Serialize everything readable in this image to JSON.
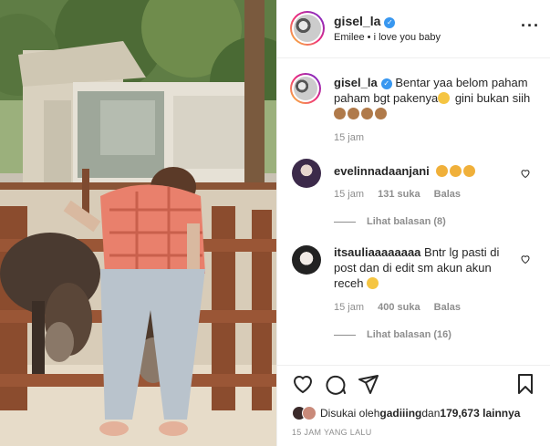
{
  "post": {
    "author": "gisel_la",
    "audio_subtitle": "Emilee • i love you baby",
    "caption_author": "gisel_la",
    "caption_text": "Bentar yaa belom paham paham bgt pakenya",
    "caption_text_2": " gini bukan siih",
    "caption_time": "15 jam"
  },
  "comments": [
    {
      "username": "evelinnadaanjani",
      "time": "15 jam",
      "likes": "131 suka",
      "reply": "Balas",
      "view_replies": "Lihat balasan (8)"
    },
    {
      "username": "itsauliaaaaaaaa",
      "text": "Bntr lg pasti di post dan di edit sm akun akun receh",
      "time": "15 jam",
      "likes": "400 suka",
      "reply": "Balas",
      "view_replies": "Lihat balasan (16)"
    }
  ],
  "likes_line": {
    "prefix": "Disukai oleh ",
    "user": "gadiiing",
    "middle": " dan ",
    "count": "179,673 lainnya"
  },
  "time_ago": "15 JAM YANG LALU",
  "icons": {
    "more": "more-options-icon",
    "verified": "verified-badge-icon",
    "like": "heart-icon",
    "comment": "comment-icon",
    "share": "share-icon",
    "save": "bookmark-icon"
  },
  "colors": {
    "verified": "#3897f0",
    "muted": "#8e8e8e",
    "text": "#262626"
  }
}
